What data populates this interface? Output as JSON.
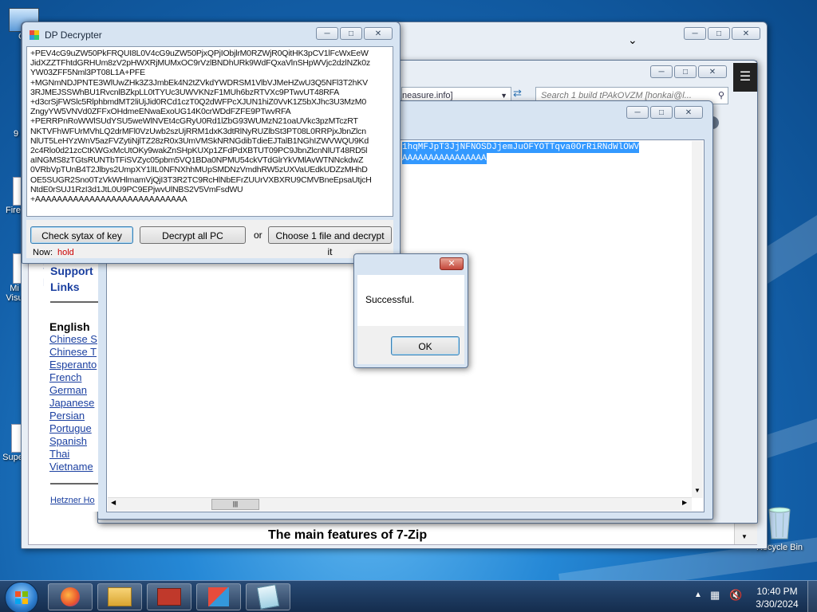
{
  "desktop": {
    "icons": [
      {
        "label": "Co"
      },
      {
        "label": "9"
      },
      {
        "label": "Firef"
      },
      {
        "label": "Mi\nVisu"
      },
      {
        "label": "Supe"
      },
      {
        "label": "Recycle Bin"
      }
    ]
  },
  "bg_window": {
    "bottom_text": "The main features of 7-Zip"
  },
  "browser_window": {
    "address_tail": "neasure.info]",
    "search_placeholder": "Search 1 build tPAkOVZM [honkai@l..."
  },
  "notepad_window": {
    "selected_line1": "1hqMFJpT3JjNFNOSDJjemJuOFYOTTqva0OrRiRNdWlOWV",
    "selected_line2": "AAAAAAAAAAAAAAAA",
    "sidebar": {
      "support_label": "Support",
      "links_label": "Links",
      "lang_heading": "English",
      "languages": [
        "Chinese S",
        "Chinese T",
        "Esperanto",
        "French",
        "German",
        "Japanese",
        "Persian",
        "Portugue",
        "Spanish",
        "Thai",
        "Vietname"
      ],
      "footer_link": "Hetzner Ho"
    }
  },
  "decrypter": {
    "title": "DP Decrypter",
    "key_lines": [
      "+PEV4cG9uZW50PkFRQUI8L0V4cG9uZW50PjxQPjIObjlrM0RZWjR0QitHK3pCV1lFcWxEeW",
      "JidXZZTFhtdGRHUm8zV2pHWXRjMUMxOC9rVzlBNDhURk9WdFQxaVlnSHpWVjc2dzlNZk0z",
      "YW03ZFF5Nml3PT08L1A+PFE",
      "+MGNmNDJPNTE3WlUwZHk3Z3JmbEk4N2tZVkdYWDRSM1VlbVJMeHZwU3Q5NFl3T2hKV",
      "3RJMEJSSWhBU1RvcnlBZkpLL0tTYUc3UWVKNzF1MUh6bzRTVXc9PTwvUT48RFA",
      "+d3crSjFWSlc5RlphbmdMT2liUjJid0RCd1czT0Q2dWFPcXJUN1hiZ0VvK1Z5bXJhc3U3MzM0",
      "ZngyYW5VNVd0ZFFxOHdmeENwaExoUG14K0crWDdFZFE9PTwvRFA",
      "+PERRPnRoWWlSUdYSU5weWlNVEt4cGRyU0Rd1lZbG93WUMzN21oaUVkc3pzMTczRT",
      "NKTVFhWFUrMVhLQ2drMFl0VzUwb2szUjRRM1dxK3dtRlNyRUZlbSt3PT08L0RRPjxJbnZlcn",
      "NlUT5LeHYzWnV5azFVZytiNjlTZ28zR0x3UmVMSkNRNGdibTdieEJTalB1NGhIZWVWQU9Kd",
      "2c4Rlo0d21zcCtKWGxMcUtOKy9wakZnSHpKUXp1ZFdPdXBTUT09PC9JbnZlcnNlUT48RD5l",
      "aINGMS8zTGtsRUNTbTFiSVZyc05pbm5VQ1BDa0NPMU54ckVTdGlrYkVMlAvWTNNckdwZ",
      "0VRbVpTUnB4T2Jlbys2UmpXY1lIL0NFNXhhMUpSMDNzVmdhRW5zUXVaUEdkUDZzMHhD",
      "OE5SUGR2Sno0TzVkWHlmamVjQjI3T3R2TC9RcHlNbEFrZUUrVXBXRU9CMVBneEpsaUtjcH",
      "NtdE0rSUJ1RzI3d1JtL0U9PC9EPjwvUlNBS2V5VmFsdWU",
      "+AAAAAAAAAAAAAAAAAAAAAAAAAAAA"
    ],
    "buttons": {
      "check_syntax": "Check sytax of key",
      "decrypt_all": "Decrypt all PC",
      "or_label": "or",
      "choose_file": "Choose 1 file and decrypt it"
    },
    "status_label": "Now:",
    "status_value": "hold",
    "status_color": "#cc0000"
  },
  "message_box": {
    "message": "Successful.",
    "ok_label": "OK"
  },
  "taskbar": {
    "time": "10:40 PM",
    "date": "3/30/2024",
    "apps": [
      "firefox-icon",
      "file-explorer-icon",
      "toolbox-icon",
      "control-panel-icon",
      "notepad-icon"
    ]
  }
}
